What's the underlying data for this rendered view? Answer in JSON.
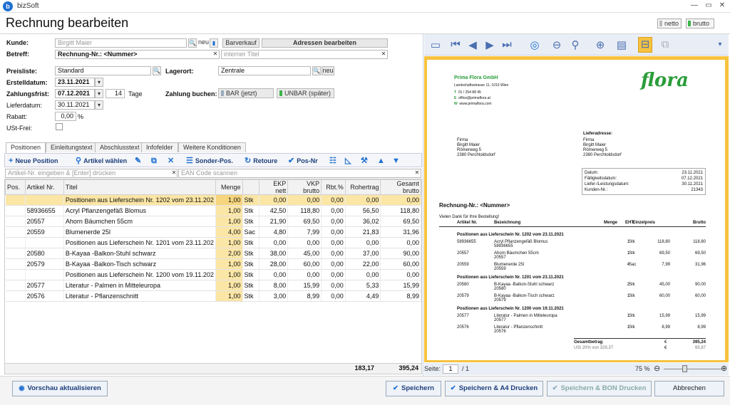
{
  "app": {
    "name": "bizSoft",
    "title": "Rechnung bearbeiten"
  },
  "window": {
    "minimize": "—",
    "maximize": "▭",
    "close": "✕"
  },
  "price_mode": {
    "netto": "netto",
    "brutto": "brutto"
  },
  "form": {
    "kunde_label": "Kunde:",
    "kunde_value": "Birgitt Maier",
    "neu": "neu",
    "barverkauf": "Barverkauf",
    "adressen": "Adressen bearbeiten",
    "betreff_label": "Betreff:",
    "betreff_value": "Rechnung-Nr.: <Nummer>",
    "interner_titel_ph": "interner Titel",
    "preisliste_label": "Preisliste:",
    "preisliste_value": "Standard",
    "lagerort_label": "Lagerort:",
    "lagerort_value": "Zentrale",
    "erstelldatum_label": "Erstelldatum:",
    "erstelldatum_value": "23.11.2021",
    "zahlungsfrist_label": "Zahlungsfrist:",
    "zahlungsfrist_value": "07.12.2021",
    "tage_value": "14",
    "tage_label": "Tage",
    "lieferdatum_label": "Lieferdatum:",
    "lieferdatum_value": "30.11.2021",
    "rabatt_label": "Rabatt:",
    "rabatt_value": "0,00",
    "rabatt_unit": "%",
    "ustfrei_label": "USt-Frei:",
    "zahlung_label": "Zahlung buchen:",
    "bar_jetzt": "BAR (jetzt)",
    "unbar_spaeter": "UNBAR (später)"
  },
  "tabs": [
    "Positionen",
    "Einleitungstext",
    "Abschlusstext",
    "Infofelder",
    "Weitere Konditionen"
  ],
  "toolbar": {
    "neue_position": "Neue Position",
    "artikel_waehlen": "Artikel wählen",
    "sonder_pos": "Sonder-Pos.",
    "retoure": "Retoure",
    "pos_nr": "Pos-Nr"
  },
  "search": {
    "artikel_ph": "Artikel-Nr. eingeben & [Enter] drücken",
    "ean_ph": "EAN Code scannen"
  },
  "columns": [
    "Pos.",
    "Artikel Nr.",
    "Titel",
    "Menge",
    "",
    "EKP nett",
    "VKP brutto",
    "Rbt.%",
    "Rohertrag",
    "Gesamt brutto"
  ],
  "rows": [
    {
      "pos": "",
      "nr": "",
      "titel": "Positionen aus Lieferschein Nr. 1202 vom 23.11.202",
      "menge": "1,00",
      "einh": "Stk",
      "ekp": "0,00",
      "vkp": "0,00",
      "rbt": "0,00",
      "roh": "0,00",
      "ges": "0,00",
      "sel": true
    },
    {
      "pos": "",
      "nr": "58936655",
      "titel": "Acryl Pflanzengefäß Blomus",
      "menge": "1,00",
      "einh": "Stk",
      "ekp": "42,50",
      "vkp": "118,80",
      "rbt": "0,00",
      "roh": "56,50",
      "ges": "118,80",
      "sel": false
    },
    {
      "pos": "",
      "nr": "20557",
      "titel": "Ahorn Bäumchen 55cm",
      "menge": "1,00",
      "einh": "Stk",
      "ekp": "21,90",
      "vkp": "69,50",
      "rbt": "0,00",
      "roh": "36,02",
      "ges": "69,50",
      "sel": false
    },
    {
      "pos": "",
      "nr": "20559",
      "titel": "Blumenerde 25l",
      "menge": "4,00",
      "einh": "Sac",
      "ekp": "4,80",
      "vkp": "7,99",
      "rbt": "0,00",
      "roh": "21,83",
      "ges": "31,96",
      "sel": false
    },
    {
      "pos": "",
      "nr": "",
      "titel": "Positionen aus Lieferschein Nr. 1201 vom 23.11.202",
      "menge": "1,00",
      "einh": "Stk",
      "ekp": "0,00",
      "vkp": "0,00",
      "rbt": "0,00",
      "roh": "0,00",
      "ges": "0,00",
      "sel": false
    },
    {
      "pos": "",
      "nr": "20580",
      "titel": "B-Kayaa -Balkon-Stuhl schwarz",
      "menge": "2,00",
      "einh": "Stk",
      "ekp": "38,00",
      "vkp": "45,00",
      "rbt": "0,00",
      "roh": "37,00",
      "ges": "90,00",
      "sel": false
    },
    {
      "pos": "",
      "nr": "20579",
      "titel": "B-Kayaa -Balkon-Tisch schwarz",
      "menge": "1,00",
      "einh": "Stk",
      "ekp": "28,00",
      "vkp": "60,00",
      "rbt": "0,00",
      "roh": "22,00",
      "ges": "60,00",
      "sel": false
    },
    {
      "pos": "",
      "nr": "",
      "titel": "Positionen aus Lieferschein Nr. 1200 vom 19.11.202",
      "menge": "1,00",
      "einh": "Stk",
      "ekp": "0,00",
      "vkp": "0,00",
      "rbt": "0,00",
      "roh": "0,00",
      "ges": "0,00",
      "sel": false
    },
    {
      "pos": "",
      "nr": "20577",
      "titel": "Literatur - Palmen in Mitteleuropa",
      "menge": "1,00",
      "einh": "Stk",
      "ekp": "8,00",
      "vkp": "15,99",
      "rbt": "0,00",
      "roh": "5,33",
      "ges": "15,99",
      "sel": false
    },
    {
      "pos": "",
      "nr": "20576",
      "titel": "Literatur - Pflanzenschnitt",
      "menge": "1,00",
      "einh": "Stk",
      "ekp": "3,00",
      "vkp": "8,99",
      "rbt": "0,00",
      "roh": "4,49",
      "ges": "8,99",
      "sel": false
    }
  ],
  "totals": {
    "rohertrag": "183,17",
    "gesamt": "395,24"
  },
  "buttons": {
    "vorschau": "Vorschau aktualisieren",
    "speichern": "Speichern",
    "speichern_a4": "Speichern & A4 Drucken",
    "speichern_bon": "Speichern & BON Drucken",
    "abbrechen": "Abbrechen"
  },
  "preview": {
    "company": "Prima Flora GmbH",
    "address": "Landschaftsstrasse 11, 1010 Wien",
    "tel": "01 / 254 88 45",
    "email": "office@primaflora.at",
    "web": "www.primaflora.com",
    "logo": "flora",
    "recipient": [
      "Firma",
      "Birgitt Maier",
      "Römerweg 5",
      "2380 Perchtoldsdorf"
    ],
    "delivery_label": "Lieferadresse:",
    "delivery": [
      "Firma",
      "Birgitt Maier",
      "Römerweg 5",
      "2380 Perchtoldsdorf"
    ],
    "info": [
      [
        "Datum:",
        "23.11.2021"
      ],
      [
        "Fälligkeitsdatum:",
        "07.12.2021"
      ],
      [
        "Liefer-/Leistungsdatum:",
        "30.11.2021"
      ],
      [
        "Kunden-Nr.:",
        "21343"
      ]
    ],
    "heading": "Rechnung-Nr.: <Nummer>",
    "thanks": "Vielen Dank für Ihre Bestellung!",
    "cols": [
      "Artikel Nr.",
      "Bezeichnung",
      "Menge",
      "EHT",
      "Einzelpreis",
      "Brutto"
    ],
    "groups": [
      {
        "title": "Positionen aus Lieferschein Nr. 1202 vom 23.11.2021",
        "items": [
          {
            "nr": "58936655",
            "bez": "Acryl Pflanzengefäß Blomus",
            "sub": "58936655",
            "menge": "1",
            "eht": "Stk",
            "ep": "118,80",
            "br": "118,80"
          },
          {
            "nr": "20557",
            "bez": "Ahorn Bäumchen 55cm",
            "sub": "20557",
            "menge": "1",
            "eht": "Stk",
            "ep": "69,50",
            "br": "69,50"
          },
          {
            "nr": "20559",
            "bez": "Blumenerde 25l",
            "sub": "20559",
            "menge": "4",
            "eht": "Sac",
            "ep": "7,99",
            "br": "31,96"
          }
        ]
      },
      {
        "title": "Positionen aus Lieferschein Nr. 1201 vom 23.11.2021",
        "items": [
          {
            "nr": "20580",
            "bez": "B-Kayaa -Balkon-Stuhl schwarz",
            "sub": "20580",
            "menge": "2",
            "eht": "Stk",
            "ep": "45,00",
            "br": "90,00"
          },
          {
            "nr": "20579",
            "bez": "B-Kayaa -Balkon-Tisch schwarz",
            "sub": "20579",
            "menge": "1",
            "eht": "Stk",
            "ep": "60,00",
            "br": "60,00"
          }
        ]
      },
      {
        "title": "Positionen aus Lieferschein Nr. 1200 vom 19.11.2021",
        "items": [
          {
            "nr": "20577",
            "bez": "Literatur - Palmen in Mitteleuropa",
            "sub": "20577",
            "menge": "1",
            "eht": "Stk",
            "ep": "15,99",
            "br": "15,99"
          },
          {
            "nr": "20576",
            "bez": "Literatur - Pflanzenschnitt",
            "sub": "20576",
            "menge": "1",
            "eht": "Stk",
            "ep": "8,99",
            "br": "8,99"
          }
        ]
      }
    ],
    "gesamt_label": "Gesamtbetrag",
    "gesamt_cur": "€",
    "gesamt": "395,24",
    "ust_label": "USt 20% von 329,37",
    "ust_cur": "€",
    "ust": "65,87"
  },
  "preview_status": {
    "seite_label": "Seite:",
    "seite": "1",
    "of": "/ 1",
    "zoom": "75 %"
  },
  "colors": {
    "accent": "#1e6fd0",
    "highlight": "#fbe6a6",
    "preview_bg": "#f7c23e",
    "brand_green": "#2a9d3a"
  }
}
